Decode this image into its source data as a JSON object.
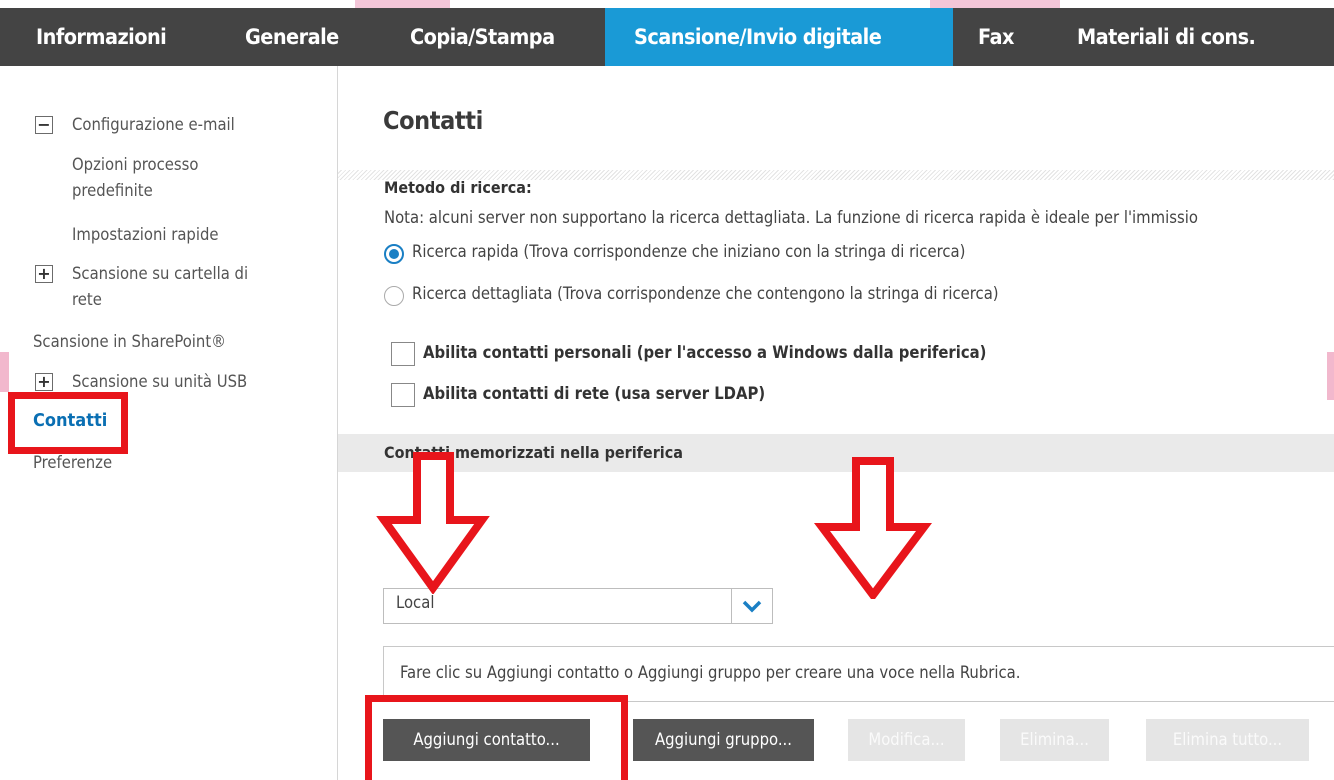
{
  "nav": {
    "tabs": [
      {
        "label": "Informazioni",
        "active": false
      },
      {
        "label": "Generale",
        "active": false
      },
      {
        "label": "Copia/Stampa",
        "active": false
      },
      {
        "label": "Scansione/Invio digitale",
        "active": true
      },
      {
        "label": "Fax",
        "active": false
      },
      {
        "label": "Materiali di cons.",
        "active": false
      }
    ]
  },
  "sidebar": {
    "items": [
      {
        "label": "Configurazione e-mail",
        "expander": "−"
      },
      {
        "label_line1": "Opzioni processo",
        "label_line2": "predefinite"
      },
      {
        "label": "Impostazioni rapide"
      },
      {
        "label_line1": "Scansione su cartella di",
        "label_line2": "rete",
        "expander": "+"
      },
      {
        "label": "Scansione in SharePoint®"
      },
      {
        "label": "Scansione su unità USB",
        "expander": "+"
      },
      {
        "label": "Contatti",
        "active": true
      },
      {
        "label": "Preferenze"
      }
    ]
  },
  "main": {
    "title": "Contatti",
    "search_method_label": "Metodo di ricerca:",
    "note": "Nota: alcuni server non supportano la ricerca dettagliata. La funzione di ricerca rapida è ideale per l'immissio",
    "radio_quick": "Ricerca rapida (Trova corrispondenze che iniziano con la stringa di ricerca)",
    "radio_detailed": "Ricerca dettagliata (Trova corrispondenze che contengono la stringa di ricerca)",
    "cb_personal": "Abilita contatti personali (per l'accesso a Windows dalla periferica)",
    "cb_network": "Abilita contatti di rete (usa server LDAP)",
    "section_heading": "Contatti memorizzati nella periferica",
    "select_value": "Local",
    "empty_message": "Fare clic su Aggiungi contatto o Aggiungi gruppo per creare una voce nella Rubrica.",
    "buttons": {
      "add_contact": "Aggiungi contatto...",
      "add_group": "Aggiungi gruppo...",
      "edit": "Modifica...",
      "delete": "Elimina...",
      "delete_all": "Elimina tutto..."
    }
  },
  "colors": {
    "nav_bg": "#444444",
    "nav_active": "#1a9ad6",
    "annotation_red": "#e8151b",
    "link_active": "#0a6fb3"
  }
}
